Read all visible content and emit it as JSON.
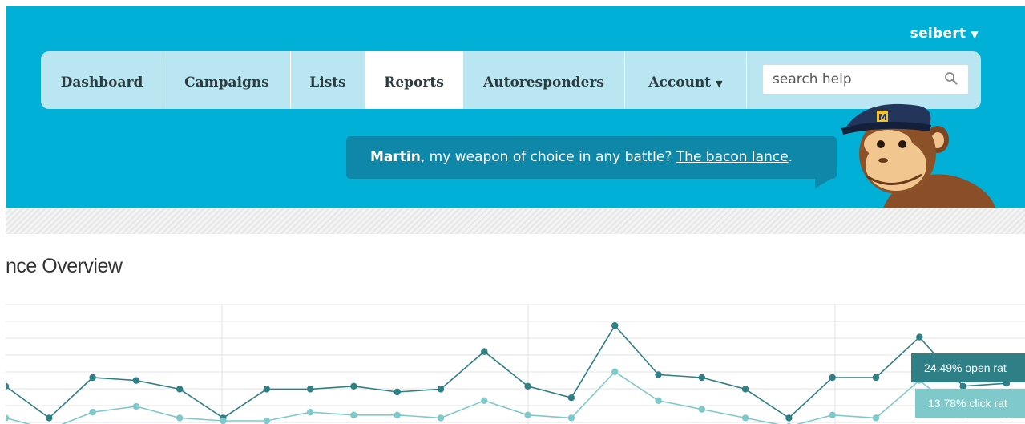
{
  "header": {
    "user": {
      "name": "seibert",
      "caret": "▼"
    },
    "nav": [
      {
        "label": "Dashboard"
      },
      {
        "label": "Campaigns"
      },
      {
        "label": "Lists"
      },
      {
        "label": "Reports",
        "active": true
      },
      {
        "label": "Autoresponders"
      },
      {
        "label": "Account",
        "caret": "▼"
      }
    ],
    "search": {
      "placeholder": "search help"
    },
    "greeting": {
      "name": "Martin",
      "text": ", my weapon of choice in any battle? ",
      "link": "The bacon lance",
      "end": "."
    }
  },
  "main": {
    "title": "nce Overview"
  },
  "chart_data": {
    "type": "line",
    "series": [
      {
        "name": "open rate",
        "values": [
          12,
          1,
          15,
          14,
          11,
          1,
          11,
          11,
          12,
          10,
          11,
          24,
          12,
          8,
          33,
          16,
          15,
          11,
          1,
          15,
          15,
          29,
          12,
          13
        ],
        "color": "#2f7f86"
      },
      {
        "name": "click rate",
        "values": [
          1,
          -3,
          3,
          5,
          1,
          0,
          0,
          3,
          2,
          2,
          1,
          7,
          2,
          1,
          17,
          7,
          4,
          1,
          -2,
          2,
          1,
          14,
          2,
          2
        ],
        "color": "#7fc9cb"
      }
    ],
    "tooltips": [
      {
        "text": "24.49% open rat",
        "color": "#2f7f86"
      },
      {
        "text": "13.78% click rat",
        "color": "#7fc9cb"
      }
    ]
  }
}
